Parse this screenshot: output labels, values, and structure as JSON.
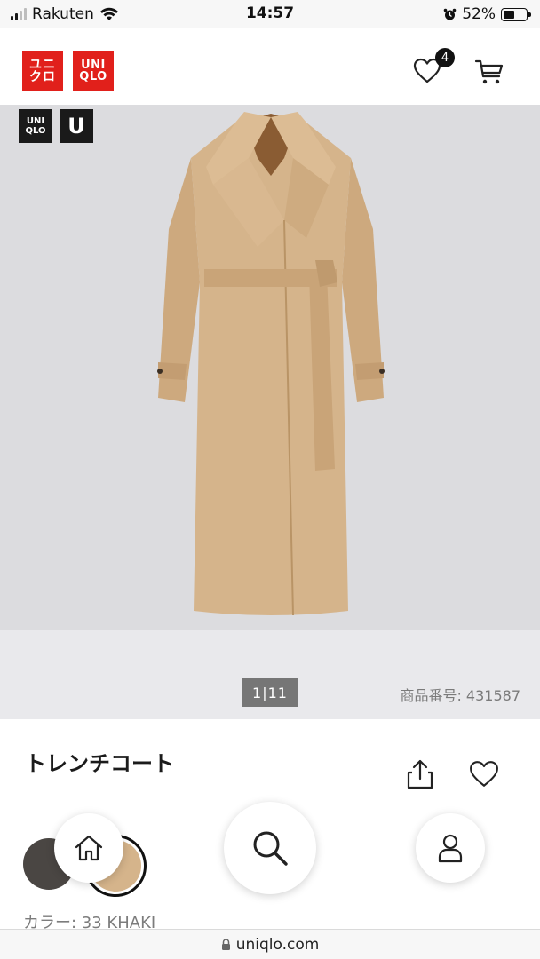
{
  "status_bar": {
    "carrier": "Rakuten",
    "time": "14:57",
    "battery_percent": "52%",
    "battery_level": 0.52
  },
  "header": {
    "logo_kana_line1": "ユニ",
    "logo_kana_line2": "クロ",
    "logo_latin_line1": "UNI",
    "logo_latin_line2": "QLO",
    "favorites_count": "4"
  },
  "hero": {
    "badge_uniqlo_line1": "UNI",
    "badge_uniqlo_line2": "QLO",
    "badge_u": "U",
    "coat_color": "#d5b48b"
  },
  "gallery": {
    "counter": "1|11",
    "product_code": "商品番号: 431587"
  },
  "product": {
    "name": "トレンチコート",
    "color_label": "カラー: 33 KHAKI",
    "swatches": [
      {
        "name": "dark",
        "color": "#4a4643",
        "selected": false
      },
      {
        "name": "khaki",
        "color": "#d5b48b",
        "selected": true
      }
    ]
  },
  "url_bar": {
    "url": "uniqlo.com"
  },
  "colors": {
    "brand_red": "#e1201b",
    "text_dark": "#1b1b1b",
    "text_muted": "#7a7a7a"
  }
}
